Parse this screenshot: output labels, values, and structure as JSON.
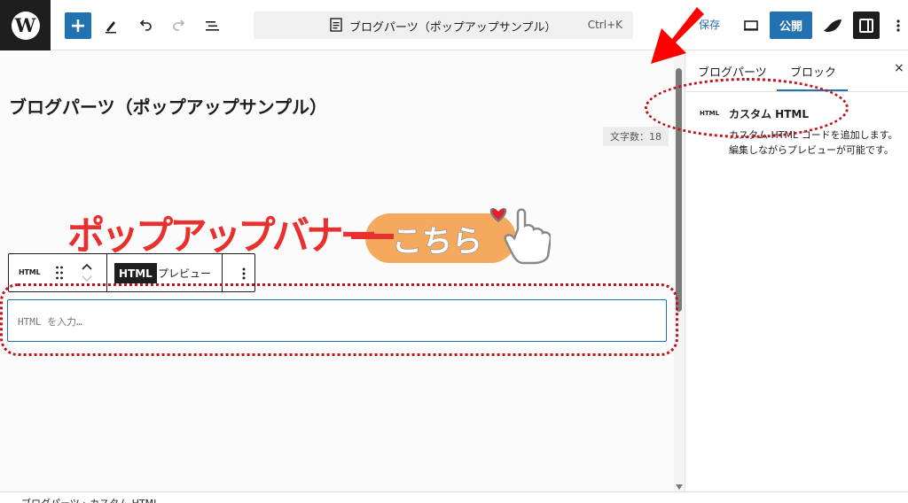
{
  "app": {
    "logo": "W"
  },
  "toolbar": {
    "add_label": "+",
    "command_title": "ブログパーツ（ポップアップサンプル）",
    "command_shortcut": "Ctrl+K",
    "save_label": "保存",
    "publish_label": "公開"
  },
  "editor": {
    "post_title": "ブログパーツ（ポップアップサンプル）",
    "word_count": "文字数：18",
    "banner": {
      "main_text": "ポップアップバナー",
      "button_text": "こちら",
      "text_color": "#e8302f",
      "button_color": "#f5a95f"
    },
    "block_toolbar": {
      "block_icon": "HTML",
      "tab_html": "HTML",
      "tab_preview": "プレビュー"
    },
    "html_input": {
      "placeholder": "HTML を入力…"
    }
  },
  "sidebar": {
    "tabs": [
      "ブログパーツ",
      "ブロック"
    ],
    "active_tab": "ブロック",
    "close": "×",
    "block": {
      "icon": "HTML",
      "title": "カスタム HTML",
      "description": "カスタム HTML コードを追加します。編集しながらプレビューが可能です。"
    }
  },
  "footer": {
    "breadcrumb": "ブログパーツ › カスタム HTML"
  },
  "annotations": {
    "color": "#c0141c",
    "arrow_color": "#ff0000"
  },
  "colors": {
    "accent": "#2271b1",
    "dark": "#1e1e1e"
  }
}
